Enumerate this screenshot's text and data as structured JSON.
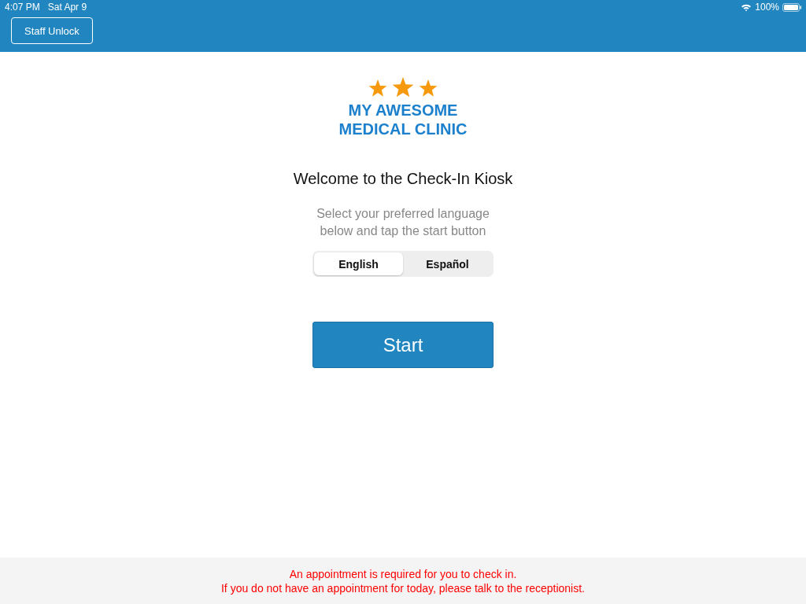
{
  "status_bar": {
    "time": "4:07 PM",
    "date": "Sat Apr 9",
    "battery": "100%"
  },
  "header": {
    "button": "Staff Unlock"
  },
  "logo": {
    "lines": [
      "MY AWESOME",
      "MEDICAL CLINIC"
    ]
  },
  "title": "Welcome to the Check-In Kiosk",
  "instructions": [
    "Select your preferred language",
    "below and tap the start button"
  ],
  "languages": [
    {
      "label": "English",
      "selected": true
    },
    {
      "label": "Español",
      "selected": false
    }
  ],
  "start_button": "Start",
  "footer": [
    "An appointment is required for you to check in.",
    "If you do not have an appointment for today, please talk to the receptionist."
  ]
}
